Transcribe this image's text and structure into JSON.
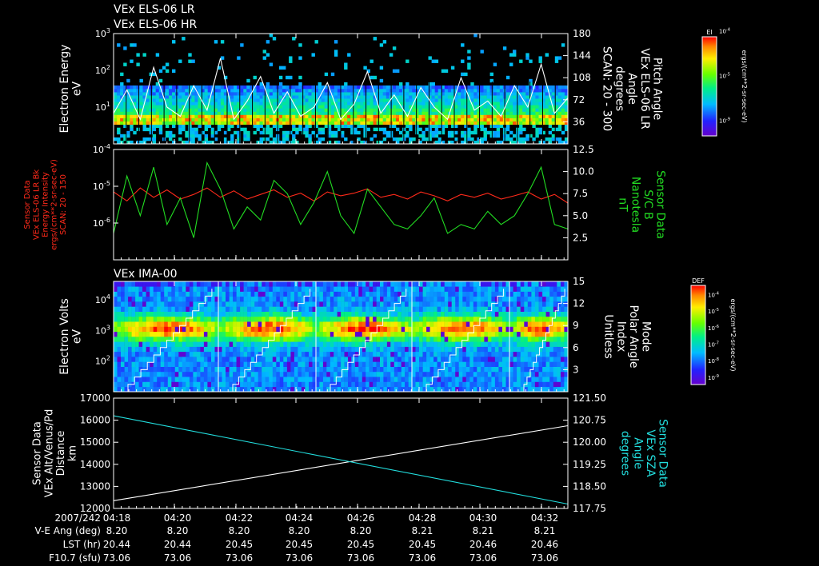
{
  "colors": {
    "background": "#000000",
    "foreground": "#ffffff",
    "red": "#ff2a1a",
    "green": "#22dd22",
    "cyan": "#22dddd"
  },
  "chart_data": [
    {
      "type": "heatmap",
      "name": "electron-energy-spectrogram",
      "title_lines": [
        "VEx ELS-06 LR",
        "VEx ELS-06 HR"
      ],
      "ylabel_lines": [
        "Electron Energy",
        "eV"
      ],
      "ylim": [
        1,
        1000
      ],
      "log_y": true,
      "y_ticks": [
        {
          "value": 10,
          "mant": "10",
          "exp": "1"
        },
        {
          "value": 100,
          "mant": "10",
          "exp": "2"
        },
        {
          "value": 1000,
          "mant": "10",
          "exp": "3"
        }
      ],
      "right_axis": {
        "label_lines": [
          "Pitch Angle",
          "VEx ELS-06 LR",
          "Angle",
          "degrees",
          "SCAN: 20 - 300"
        ],
        "ylim": [
          0,
          180
        ],
        "ticks": [
          "36",
          "72",
          "108",
          "144",
          "180"
        ]
      },
      "colorbar": {
        "title": "El",
        "unit": "ergs/(cm**2-sr-sec-eV)",
        "ticks": [
          {
            "mant": "10",
            "exp": "-9"
          },
          {
            "mant": "10",
            "exp": "-5"
          },
          {
            "mant": "10",
            "exp": "-4"
          }
        ]
      },
      "series": [
        {
          "color": "#ffffff",
          "values": [
            50,
            88,
            40,
            125,
            60,
            45,
            95,
            55,
            140,
            40,
            70,
            110,
            50,
            85,
            45,
            60,
            100,
            40,
            65,
            118,
            50,
            80,
            45,
            92,
            60,
            40,
            108,
            55,
            70,
            45,
            95,
            60,
            130,
            50,
            75
          ]
        }
      ]
    },
    {
      "type": "line",
      "name": "energy-intensity-and-magnetic-field",
      "ylabel_lines": [
        "Sensor Data",
        "VEx ELS-06 LR Bk",
        "Energy Intensity",
        "ergs/(cm**2-sr-sec-eV)",
        "SCAN: 20 - 150"
      ],
      "ylim": [
        1e-07,
        0.0001
      ],
      "log_y": true,
      "y_ticks": [
        {
          "value": 1e-06,
          "mant": "10",
          "exp": "-6"
        },
        {
          "value": 1e-05,
          "mant": "10",
          "exp": "-5"
        },
        {
          "value": 0.0001,
          "mant": "10",
          "exp": "-4"
        }
      ],
      "right_axis": {
        "label_lines": [
          "Sensor Data",
          "S/C B",
          "Nanotesla",
          "nT"
        ],
        "ylim": [
          0,
          12.5
        ],
        "ticks": [
          "2.5",
          "5.0",
          "7.5",
          "10.0",
          "12.5"
        ]
      },
      "series": [
        {
          "color": "#ff2a1a",
          "axis": "left",
          "values": [
            7e-06,
            4e-06,
            9e-06,
            5e-06,
            8e-06,
            4.5e-06,
            6e-06,
            9e-06,
            5e-06,
            7.5e-06,
            4.5e-06,
            6e-06,
            8e-06,
            5e-06,
            6.5e-06,
            4e-06,
            7e-06,
            5.5e-06,
            6.5e-06,
            8.5e-06,
            5e-06,
            6e-06,
            4.5e-06,
            7e-06,
            5.5e-06,
            4e-06,
            6e-06,
            5e-06,
            6.5e-06,
            4.5e-06,
            5.5e-06,
            7e-06,
            4.5e-06,
            6e-06,
            3.5e-06
          ]
        },
        {
          "color": "#22dd22",
          "axis": "right",
          "values": [
            3.0,
            9.5,
            5.0,
            10.5,
            4.0,
            7.0,
            2.5,
            11.0,
            8.0,
            3.5,
            6.0,
            4.5,
            9.0,
            7.5,
            4.0,
            6.5,
            10.0,
            5.0,
            3.0,
            8.0,
            6.0,
            4.0,
            3.5,
            5.0,
            7.0,
            3.0,
            4.0,
            3.5,
            5.5,
            4.0,
            5.0,
            7.5,
            10.5,
            4.0,
            3.5
          ]
        }
      ]
    },
    {
      "type": "heatmap",
      "name": "ima-ion-spectrogram",
      "title_lines": [
        "VEx IMA-00"
      ],
      "ylabel_lines": [
        "Electron Volts",
        "eV"
      ],
      "ylim": [
        10,
        40000
      ],
      "log_y": true,
      "y_ticks": [
        {
          "value": 100,
          "mant": "10",
          "exp": "2"
        },
        {
          "value": 1000,
          "mant": "10",
          "exp": "3"
        },
        {
          "value": 10000,
          "mant": "10",
          "exp": "4"
        }
      ],
      "right_axis": {
        "label_lines": [
          "Mode",
          "Polar Angle",
          "Index",
          "Unitless"
        ],
        "ylim": [
          0,
          15
        ],
        "ticks": [
          "3",
          "6",
          "9",
          "12",
          "15"
        ]
      },
      "colorbar": {
        "title": "DEF",
        "unit": "ergs/(cm**2-sr-sec-eV)",
        "ticks": [
          {
            "mant": "10",
            "exp": "-9"
          },
          {
            "mant": "10",
            "exp": "-8"
          },
          {
            "mant": "10",
            "exp": "-7"
          },
          {
            "mant": "10",
            "exp": "-6"
          },
          {
            "mant": "10",
            "exp": "-5"
          },
          {
            "mant": "10",
            "exp": "-4"
          }
        ]
      }
    },
    {
      "type": "line",
      "name": "altitude-and-sza",
      "ylabel_lines": [
        "Sensor Data",
        "VEx Alt/Venus/Pd",
        "Distance",
        "km"
      ],
      "ylim": [
        12000,
        17000
      ],
      "y_ticks": [
        "12000",
        "13000",
        "14000",
        "15000",
        "16000",
        "17000"
      ],
      "right_axis": {
        "label_lines": [
          "Sensor Data",
          "VEx SZA",
          "Angle",
          "degrees"
        ],
        "ylim": [
          117.75,
          121.5
        ],
        "ticks": [
          "117.75",
          "118.50",
          "119.25",
          "120.00",
          "120.75",
          "121.50"
        ]
      },
      "series": [
        {
          "color": "#ffffff",
          "axis": "left",
          "values": [
            12350,
            15750
          ]
        },
        {
          "color": "#22dddd",
          "axis": "right",
          "values": [
            120.9,
            117.9
          ]
        }
      ]
    }
  ],
  "time_axis": {
    "date": "2007/242",
    "ticks": [
      "04:18",
      "04:20",
      "04:22",
      "04:24",
      "04:26",
      "04:28",
      "04:30",
      "04:32"
    ],
    "rows": [
      {
        "label": "V-E Ang (deg)",
        "values": [
          "8.20",
          "8.20",
          "8.20",
          "8.20",
          "8.20",
          "8.21",
          "8.21",
          "8.21"
        ]
      },
      {
        "label": "LST (hr)",
        "values": [
          "20.44",
          "20.44",
          "20.45",
          "20.45",
          "20.45",
          "20.45",
          "20.46",
          "20.46"
        ]
      },
      {
        "label": "F10.7 (sfu)",
        "values": [
          "73.06",
          "73.06",
          "73.06",
          "73.06",
          "73.06",
          "73.06",
          "73.06",
          "73.06"
        ]
      }
    ]
  }
}
